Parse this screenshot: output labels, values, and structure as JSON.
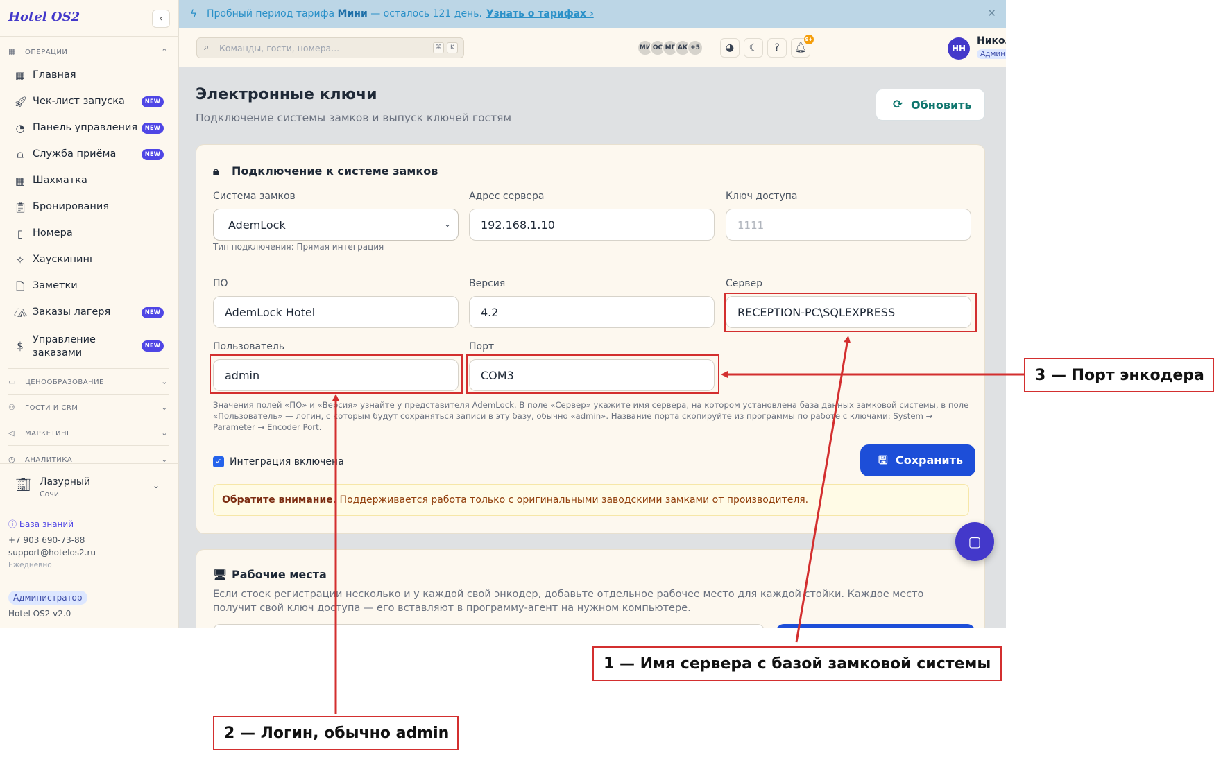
{
  "app": {
    "logo": "Hotel OS2"
  },
  "sidebar": {
    "sections": [
      {
        "label": "ОПЕРАЦИИ",
        "icon": "grid-icon",
        "chevron": "⌃"
      },
      {
        "label": "ЦЕНООБРАЗОВАНИЕ",
        "icon": "card-icon",
        "chevron": "⌄"
      },
      {
        "label": "ГОСТИ И CRM",
        "icon": "users-icon",
        "chevron": "⌄"
      },
      {
        "label": "МАРКЕТИНГ",
        "icon": "megaphone-icon",
        "chevron": "⌄"
      },
      {
        "label": "АНАЛИТИКА",
        "icon": "chart-icon",
        "chevron": "⌄"
      }
    ],
    "items": [
      {
        "label": "Главная",
        "icon": "dashboard-icon",
        "badge": ""
      },
      {
        "label": "Чек-лист запуска",
        "icon": "rocket-icon",
        "badge": "NEW"
      },
      {
        "label": "Панель управления",
        "icon": "gauge-icon",
        "badge": "NEW"
      },
      {
        "label": "Служба приёма",
        "icon": "bell-icon",
        "badge": "NEW"
      },
      {
        "label": "Шахматка",
        "icon": "grid-calendar-icon",
        "badge": ""
      },
      {
        "label": "Бронирования",
        "icon": "clipboard-icon",
        "badge": ""
      },
      {
        "label": "Номера",
        "icon": "door-icon",
        "badge": ""
      },
      {
        "label": "Хаускипинг",
        "icon": "sparkles-icon",
        "badge": ""
      },
      {
        "label": "Заметки",
        "icon": "note-icon",
        "badge": ""
      },
      {
        "label": "Заказы лагеря",
        "icon": "tent-icon",
        "badge": "NEW"
      },
      {
        "label": "Управление заказами",
        "icon": "receipt-icon",
        "badge": "NEW"
      }
    ],
    "hotel": {
      "name": "Лазурный",
      "city": "Сочи"
    },
    "knowledge_base": "База знаний",
    "phone": "+7 903 690-73-88",
    "email": "support@hotelos2.ru",
    "schedule": "Ежедневно",
    "role": "Администратор",
    "version": "Hotel OS2 v2.0"
  },
  "banner": {
    "text_before": "Пробный период тарифа ",
    "plan": "Мини",
    "text_after": " — осталось 121 день.",
    "link": "Узнать о тарифах ›",
    "close": "✕"
  },
  "topbar": {
    "search_placeholder": "Команды, гости, номера...",
    "kbd": [
      "⌘",
      "K"
    ],
    "avatars": [
      "МИ",
      "ОС",
      "МГ",
      "АК",
      "+5"
    ],
    "notifications_badge": "9+",
    "user": {
      "initials": "НН",
      "name": "Николай Надеждин",
      "role": "Администратор"
    }
  },
  "page": {
    "title": "Электронные ключи",
    "subtitle": "Подключение системы замков и выпуск ключей гостям",
    "refresh": "Обновить"
  },
  "lock_card": {
    "title": "Подключение к системе замков",
    "lock_system_label": "Система замков",
    "lock_system_value": "AdemLock",
    "connection_hint": "Тип подключения: Прямая интеграция",
    "server_address_label": "Адрес сервера",
    "server_address_value": "192.168.1.10",
    "access_key_label": "Ключ доступа",
    "access_key_placeholder": "1111",
    "software_label": "ПО",
    "software_value": "AdemLock Hotel",
    "version_label": "Версия",
    "version_value": "4.2",
    "server_label": "Сервер",
    "server_value": "RECEPTION-PC\\SQLEXPRESS",
    "user_label": "Пользователь",
    "user_value": "admin",
    "port_label": "Порт",
    "port_value": "COM3",
    "help_text": "Значения полей «ПО» и «Версия» узнайте у представителя AdemLock. В поле «Сервер» укажите имя сервера, на котором установлена база данных замковой системы, в поле «Пользователь» — логин, с которым будут сохраняться записи в эту базу, обычно «admin». Название порта скопируйте из программы по работе с ключами: System → Parameter → Encoder Port.",
    "integration_label": "Интеграция включена",
    "save": "Сохранить",
    "notice_bold": "Обратите внимание.",
    "notice_text": " Поддерживается работа только с оригинальными заводскими замками от производителя."
  },
  "workstations": {
    "title": "Рабочие места",
    "description": "Если стоек регистрации несколько и у каждой свой энкодер, добавьте отдельное рабочее место для каждой стойки. Каждое место получит свой ключ доступа — его вставляют в программу-агент на нужном компьютере."
  },
  "annotations": {
    "callout_1": "1 — Имя сервера с базой замковой системы",
    "callout_2": "2 — Логин, обычно admin",
    "callout_3": "3 — Порт энкодера",
    "color": "#d32f2f"
  },
  "colors": {
    "accent": "#4338ca",
    "primary_button": "#1d4ed8",
    "refresh_text": "#0f766e",
    "banner_bg": "#bcd6e6",
    "sidebar_bg": "#fdf8ef"
  }
}
